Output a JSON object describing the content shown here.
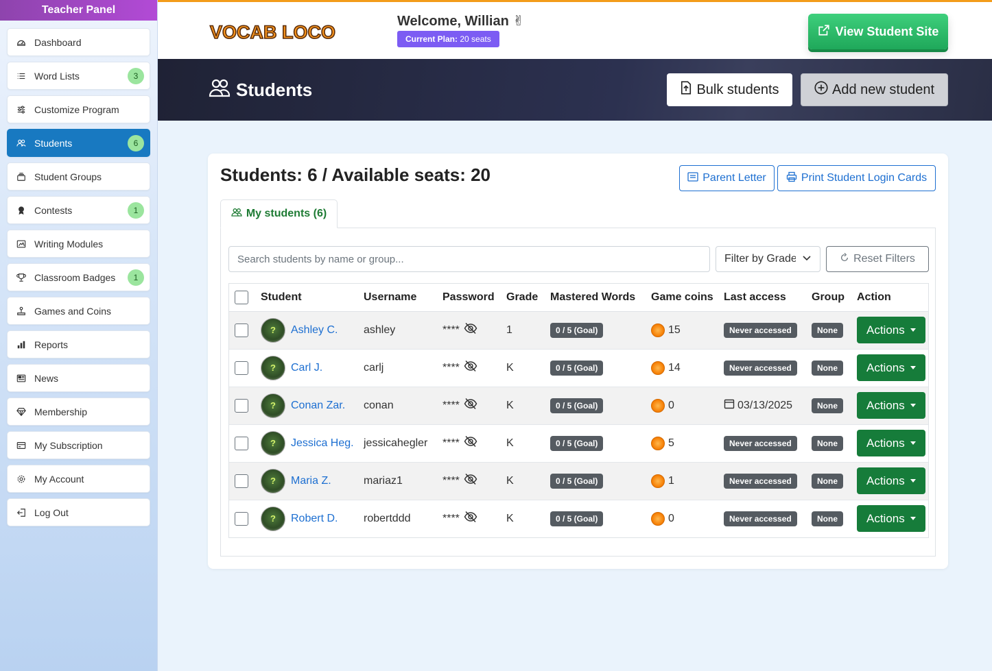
{
  "sidebar": {
    "title": "Teacher Panel",
    "items": [
      {
        "label": "Dashboard",
        "icon": "dashboard-icon",
        "badge": null,
        "active": false
      },
      {
        "label": "Word Lists",
        "icon": "list-icon",
        "badge": "3",
        "active": false
      },
      {
        "label": "Customize Program",
        "icon": "sliders-icon",
        "badge": null,
        "active": false
      },
      {
        "label": "Students",
        "icon": "people-icon",
        "badge": "6",
        "active": true
      },
      {
        "label": "Student Groups",
        "icon": "stack-icon",
        "badge": null,
        "active": false
      },
      {
        "label": "Contests",
        "icon": "award-icon",
        "badge": "1",
        "active": false
      },
      {
        "label": "Writing Modules",
        "icon": "image-icon",
        "badge": null,
        "active": false
      },
      {
        "label": "Classroom Badges",
        "icon": "trophy-icon",
        "badge": "1",
        "active": false
      },
      {
        "label": "Games and Coins",
        "icon": "joystick-icon",
        "badge": null,
        "active": false
      },
      {
        "label": "Reports",
        "icon": "bar-chart-icon",
        "badge": null,
        "active": false
      },
      {
        "label": "News",
        "icon": "newspaper-icon",
        "badge": null,
        "active": false
      },
      {
        "label": "Membership",
        "icon": "gem-icon",
        "badge": null,
        "active": false
      },
      {
        "label": "My Subscription",
        "icon": "credit-card-icon",
        "badge": null,
        "active": false
      },
      {
        "label": "My Account",
        "icon": "gear-icon",
        "badge": null,
        "active": false
      },
      {
        "label": "Log Out",
        "icon": "logout-icon",
        "badge": null,
        "active": false
      }
    ]
  },
  "header": {
    "logo_text": "VOCAB LOCO",
    "welcome": "Welcome, Willian ✌",
    "plan_label": "Current Plan:",
    "plan_value": "20 seats",
    "view_site_label": "View Student Site"
  },
  "banner": {
    "title": "Students",
    "bulk_label": "Bulk students",
    "add_label": "Add new student"
  },
  "card": {
    "title": "Students: 6 / Available seats: 20",
    "parent_letter_label": "Parent Letter",
    "print_cards_label": "Print Student Login Cards",
    "tab_label": "My students (6)",
    "search_placeholder": "Search students by name or group...",
    "grade_filter_label": "Filter by Grade",
    "reset_label": "Reset Filters"
  },
  "table": {
    "columns": [
      "Student",
      "Username",
      "Password",
      "Grade",
      "Mastered Words",
      "Game coins",
      "Last access",
      "Group",
      "Action"
    ],
    "rows": [
      {
        "name": "Ashley C.",
        "username": "ashley",
        "password": "****",
        "grade": "1",
        "mastered": "0 / 5 (Goal)",
        "coins": "15",
        "last_access": "Never accessed",
        "last_is_date": false,
        "group": "None",
        "action": "Actions"
      },
      {
        "name": "Carl J.",
        "username": "carlj",
        "password": "****",
        "grade": "K",
        "mastered": "0 / 5 (Goal)",
        "coins": "14",
        "last_access": "Never accessed",
        "last_is_date": false,
        "group": "None",
        "action": "Actions"
      },
      {
        "name": "Conan Zar.",
        "username": "conan",
        "password": "****",
        "grade": "K",
        "mastered": "0 / 5 (Goal)",
        "coins": "0",
        "last_access": "03/13/2025",
        "last_is_date": true,
        "group": "None",
        "action": "Actions"
      },
      {
        "name": "Jessica Heg.",
        "username": "jessicahegler",
        "password": "****",
        "grade": "K",
        "mastered": "0 / 5 (Goal)",
        "coins": "5",
        "last_access": "Never accessed",
        "last_is_date": false,
        "group": "None",
        "action": "Actions"
      },
      {
        "name": "Maria Z.",
        "username": "mariaz1",
        "password": "****",
        "grade": "K",
        "mastered": "0 / 5 (Goal)",
        "coins": "1",
        "last_access": "Never accessed",
        "last_is_date": false,
        "group": "None",
        "action": "Actions"
      },
      {
        "name": "Robert D.",
        "username": "robertddd",
        "password": "****",
        "grade": "K",
        "mastered": "0 / 5 (Goal)",
        "coins": "0",
        "last_access": "Never accessed",
        "last_is_date": false,
        "group": "None",
        "action": "Actions"
      }
    ]
  },
  "colors": {
    "accent_blue": "#1879c1",
    "sidebar_header": "#8e44ad",
    "action_green": "#167c3a",
    "plan_purple": "#7c5cf3"
  }
}
